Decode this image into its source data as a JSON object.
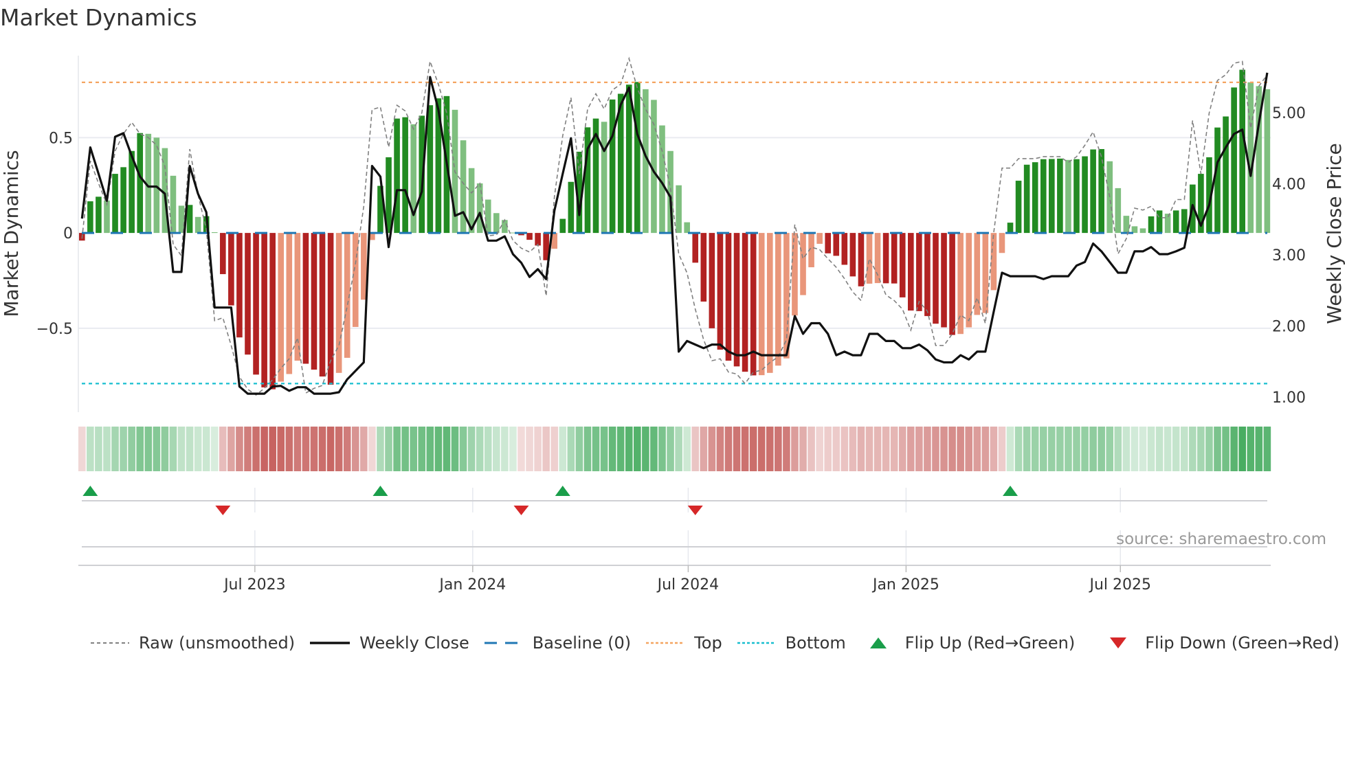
{
  "title": "Market Dynamics",
  "source": "source: sharemaestro.com",
  "legend": {
    "raw": "Raw (unsmoothed)",
    "close": "Weekly Close",
    "baseline": "Baseline (0)",
    "top": "Top",
    "bottom": "Bottom",
    "flip_up": "Flip Up (Red→Green)",
    "flip_down": "Flip Down (Green→Red)"
  },
  "colors": {
    "rise_pos": "#228b22",
    "fall_pos": "#7fbf7f",
    "fall_neg": "#b22222",
    "rise_neg": "#e9967a",
    "raw": "#808080",
    "close": "#111111",
    "baseline": "#1f77b4",
    "top": "#f4a460",
    "bottom": "#17becf",
    "flip_up": "#1a9e4a",
    "flip_down": "#d62728",
    "strip_pos": "#3aa655",
    "strip_neg": "#c0504d"
  },
  "chart_data": {
    "type": "bar",
    "title": "Market Dynamics",
    "xlabel": "",
    "ylabel": "Market Dynamics",
    "y2label": "Weekly Close Price",
    "x_start": "2023-02-05",
    "x_step_days": 7,
    "ylim": [
      -0.94,
      0.93
    ],
    "y2lim": [
      0.79,
      5.8
    ],
    "yticks": [
      {
        "v": 0.5,
        "label": "0.5"
      },
      {
        "v": 0,
        "label": "0"
      },
      {
        "v": -0.5,
        "label": "−0.5"
      }
    ],
    "y2ticks": [
      {
        "v": 5,
        "label": "5.00"
      },
      {
        "v": 4,
        "label": "4.00"
      },
      {
        "v": 3,
        "label": "3.00"
      },
      {
        "v": 2,
        "label": "2.00"
      },
      {
        "v": 1,
        "label": "1.00"
      }
    ],
    "xticks": [
      {
        "date": "2023-07-01",
        "label": "Jul 2023"
      },
      {
        "date": "2024-01-01",
        "label": "Jan 2024"
      },
      {
        "date": "2024-07-01",
        "label": "Jul 2024"
      },
      {
        "date": "2025-01-01",
        "label": "Jan 2025"
      },
      {
        "date": "2025-07-01",
        "label": "Jul 2025"
      }
    ],
    "top_level": 0.79,
    "bottom_level": -0.79,
    "baseline": 0,
    "grid": true,
    "legend_position": "bottom",
    "dynamics": [
      -0.04,
      0.166,
      0.19,
      0.17,
      0.31,
      0.345,
      0.43,
      0.524,
      0.52,
      0.5,
      0.445,
      0.3,
      0.143,
      0.147,
      0.084,
      0.088,
      0.004,
      -0.216,
      -0.38,
      -0.548,
      -0.638,
      -0.743,
      -0.81,
      -0.82,
      -0.78,
      -0.74,
      -0.67,
      -0.686,
      -0.717,
      -0.753,
      -0.796,
      -0.734,
      -0.655,
      -0.493,
      -0.35,
      -0.037,
      0.247,
      0.397,
      0.6,
      0.607,
      0.57,
      0.615,
      0.67,
      0.706,
      0.718,
      0.646,
      0.486,
      0.34,
      0.26,
      0.175,
      0.104,
      0.068,
      0.002,
      -0.012,
      -0.036,
      -0.066,
      -0.143,
      -0.083,
      0.074,
      0.268,
      0.426,
      0.554,
      0.6,
      0.583,
      0.7,
      0.73,
      0.778,
      0.792,
      0.754,
      0.698,
      0.564,
      0.43,
      0.25,
      0.056,
      -0.156,
      -0.36,
      -0.5,
      -0.612,
      -0.67,
      -0.7,
      -0.728,
      -0.747,
      -0.746,
      -0.734,
      -0.696,
      -0.658,
      -0.433,
      -0.326,
      -0.18,
      -0.057,
      -0.107,
      -0.12,
      -0.167,
      -0.228,
      -0.28,
      -0.266,
      -0.263,
      -0.264,
      -0.265,
      -0.338,
      -0.407,
      -0.41,
      -0.436,
      -0.476,
      -0.495,
      -0.535,
      -0.53,
      -0.495,
      -0.43,
      -0.42,
      -0.3,
      -0.105,
      0.054,
      0.274,
      0.358,
      0.371,
      0.387,
      0.388,
      0.39,
      0.383,
      0.387,
      0.402,
      0.438,
      0.44,
      0.376,
      0.235,
      0.09,
      0.035,
      0.024,
      0.087,
      0.118,
      0.101,
      0.118,
      0.125,
      0.254,
      0.31,
      0.397,
      0.553,
      0.611,
      0.763,
      0.856,
      0.79,
      0.77,
      0.754
    ],
    "raw": [
      -0.03,
      0.378,
      0.26,
      0.15,
      0.43,
      0.52,
      0.58,
      0.52,
      0.5,
      0.46,
      0.35,
      -0.06,
      -0.12,
      0.44,
      0.2,
      0.02,
      -0.46,
      -0.445,
      -0.59,
      -0.755,
      -0.82,
      -0.85,
      -0.815,
      -0.77,
      -0.71,
      -0.66,
      -0.55,
      -0.84,
      -0.815,
      -0.8,
      -0.67,
      -0.59,
      -0.385,
      -0.16,
      0.14,
      0.647,
      0.66,
      0.45,
      0.67,
      0.64,
      0.545,
      0.63,
      0.9,
      0.78,
      0.63,
      0.32,
      0.26,
      0.21,
      0.26,
      -0.015,
      -0.01,
      0.068,
      -0.04,
      -0.08,
      -0.1,
      -0.06,
      -0.33,
      0.19,
      0.51,
      0.71,
      0.31,
      0.65,
      0.73,
      0.65,
      0.75,
      0.78,
      0.915,
      0.76,
      0.65,
      0.57,
      0.43,
      0.235,
      -0.11,
      -0.21,
      -0.4,
      -0.56,
      -0.67,
      -0.66,
      -0.73,
      -0.74,
      -0.79,
      -0.73,
      -0.72,
      -0.68,
      -0.65,
      -0.56,
      0.044,
      -0.135,
      -0.075,
      -0.087,
      -0.135,
      -0.18,
      -0.24,
      -0.31,
      -0.355,
      -0.135,
      -0.22,
      -0.325,
      -0.355,
      -0.4,
      -0.51,
      -0.36,
      -0.41,
      -0.59,
      -0.59,
      -0.53,
      -0.43,
      -0.46,
      -0.34,
      -0.475,
      0.0,
      0.34,
      0.34,
      0.39,
      0.39,
      0.39,
      0.4,
      0.4,
      0.4,
      0.37,
      0.4,
      0.46,
      0.53,
      0.4,
      0.19,
      -0.11,
      -0.03,
      0.13,
      0.12,
      0.14,
      0.08,
      0.08,
      0.175,
      0.175,
      0.59,
      0.31,
      0.63,
      0.8,
      0.83,
      0.89,
      0.9,
      0.55,
      0.77,
      0.83
    ],
    "weekly_close": [
      3.51,
      4.51,
      4.14,
      3.76,
      4.66,
      4.71,
      4.39,
      4.1,
      3.96,
      3.96,
      3.86,
      2.76,
      2.76,
      4.25,
      3.86,
      3.6,
      2.26,
      2.26,
      2.26,
      1.15,
      1.05,
      1.05,
      1.05,
      1.15,
      1.16,
      1.09,
      1.14,
      1.14,
      1.05,
      1.05,
      1.05,
      1.07,
      1.25,
      1.37,
      1.49,
      4.25,
      4.1,
      3.11,
      3.91,
      3.91,
      3.56,
      3.89,
      5.5,
      5.04,
      4.3,
      3.55,
      3.6,
      3.36,
      3.59,
      3.2,
      3.2,
      3.26,
      3.01,
      2.89,
      2.69,
      2.8,
      2.66,
      3.62,
      4.14,
      4.64,
      3.56,
      4.49,
      4.7,
      4.46,
      4.67,
      5.11,
      5.35,
      4.7,
      4.39,
      4.17,
      4.01,
      3.81,
      1.64,
      1.79,
      1.74,
      1.69,
      1.74,
      1.74,
      1.64,
      1.59,
      1.59,
      1.64,
      1.59,
      1.59,
      1.59,
      1.59,
      2.14,
      1.89,
      2.04,
      2.04,
      1.89,
      1.59,
      1.64,
      1.59,
      1.59,
      1.89,
      1.89,
      1.79,
      1.79,
      1.69,
      1.69,
      1.74,
      1.66,
      1.53,
      1.49,
      1.49,
      1.59,
      1.53,
      1.64,
      1.64,
      2.2,
      2.75,
      2.7,
      2.7,
      2.7,
      2.7,
      2.66,
      2.7,
      2.7,
      2.7,
      2.85,
      2.9,
      3.16,
      3.05,
      2.9,
      2.75,
      2.75,
      3.05,
      3.05,
      3.11,
      3.01,
      3.01,
      3.05,
      3.1,
      3.7,
      3.41,
      3.7,
      4.3,
      4.51,
      4.7,
      4.76,
      4.11,
      4.85,
      5.56
    ]
  }
}
